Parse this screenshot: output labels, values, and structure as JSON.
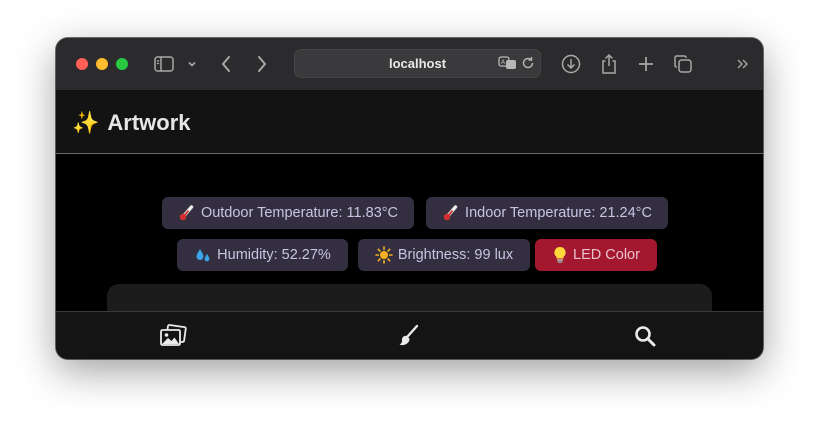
{
  "browser": {
    "url": "localhost",
    "icons": [
      "sidebar-icon",
      "chevron-down-icon",
      "back-icon",
      "forward-icon",
      "translate-icon",
      "reload-icon",
      "download-icon",
      "share-icon",
      "new-tab-icon",
      "tabs-overview-icon",
      "more-icon"
    ]
  },
  "app": {
    "title": "Artwork",
    "title_emoji": "✨"
  },
  "sensors": [
    {
      "label": "Outdoor Temperature: 11.83°C",
      "emoji": "thermometer"
    },
    {
      "label": "Indoor Temperature: 21.24°C",
      "emoji": "thermometer"
    },
    {
      "label": "Humidity: 52.27%",
      "emoji": "droplets"
    },
    {
      "label": "Brightness: 99 lux",
      "emoji": "sun"
    },
    {
      "label": "LED Color",
      "emoji": "lightbulb",
      "color": "#a3182f"
    }
  ],
  "tabs": [
    {
      "name": "gallery",
      "icon": "photos-icon"
    },
    {
      "name": "draw",
      "icon": "brush-icon"
    },
    {
      "name": "search",
      "icon": "search-icon"
    }
  ],
  "colors": {
    "chip_bg": "#332f40",
    "chip_text": "#c9c4e2",
    "led_bg": "#a3182f",
    "page_bg": "#000000",
    "header_bg": "#131314"
  }
}
